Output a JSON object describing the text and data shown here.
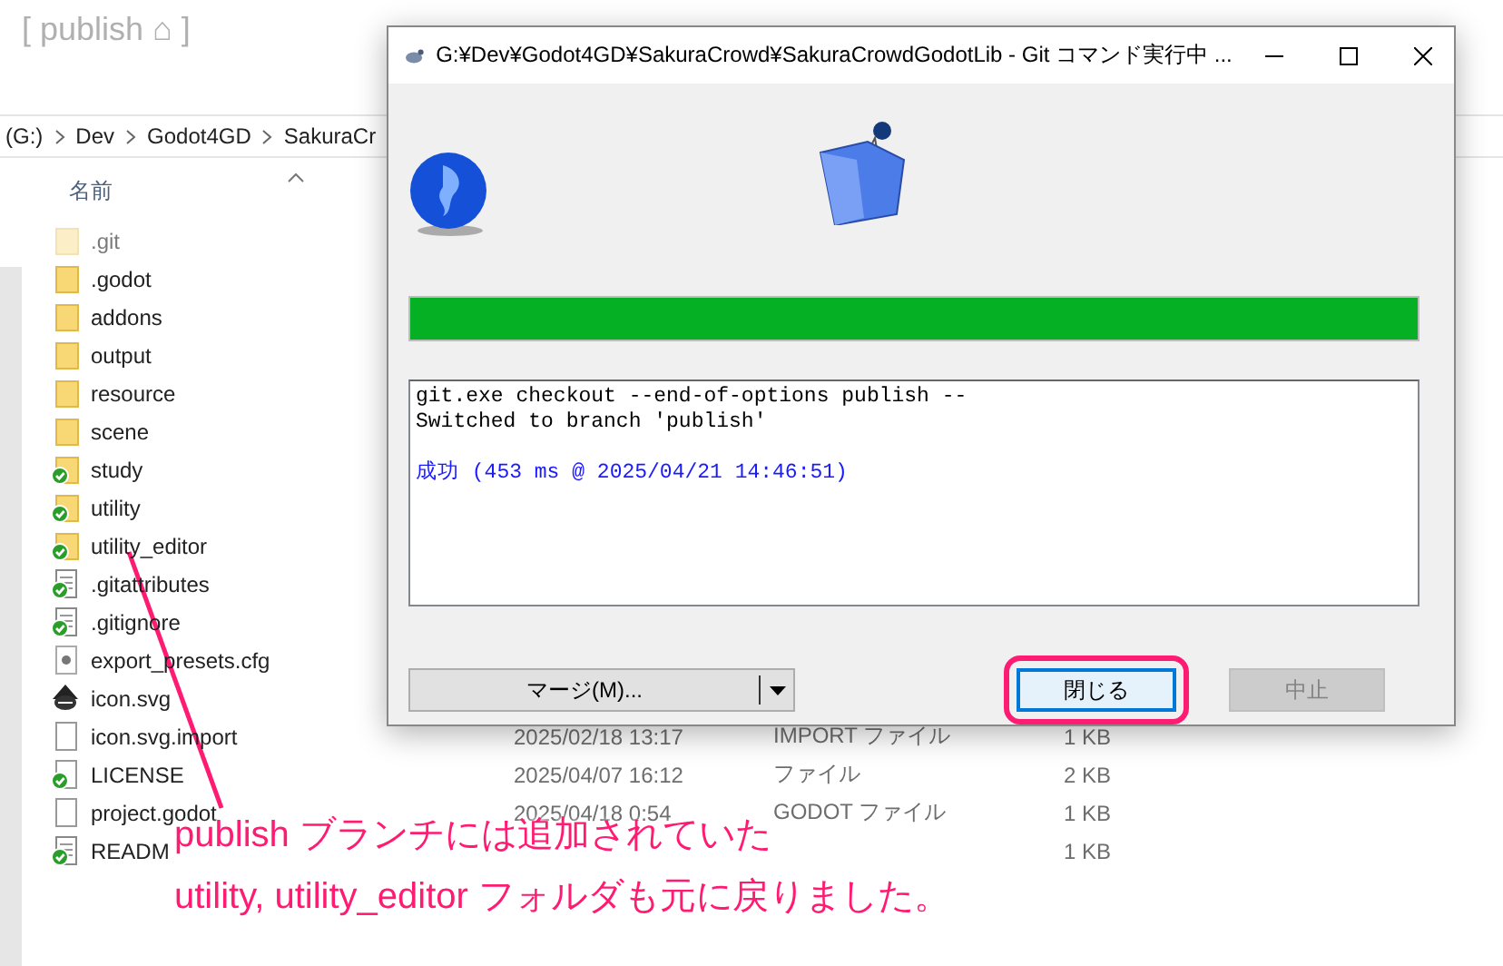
{
  "explorer": {
    "title": "[ publish ⌂ ]",
    "breadcrumb": [
      "(G:)",
      "Dev",
      "Godot4GD",
      "SakuraCr"
    ],
    "name_header": "名前",
    "files": [
      {
        "name": ".git",
        "kind": "folder",
        "hidden": true,
        "tracked": false
      },
      {
        "name": ".godot",
        "kind": "folder",
        "hidden": false,
        "tracked": false
      },
      {
        "name": "addons",
        "kind": "folder",
        "hidden": false,
        "tracked": false
      },
      {
        "name": "output",
        "kind": "folder",
        "hidden": false,
        "tracked": false
      },
      {
        "name": "resource",
        "kind": "folder",
        "hidden": false,
        "tracked": false
      },
      {
        "name": "scene",
        "kind": "folder",
        "hidden": false,
        "tracked": false
      },
      {
        "name": "study",
        "kind": "folder",
        "hidden": false,
        "tracked": true
      },
      {
        "name": "utility",
        "kind": "folder",
        "hidden": false,
        "tracked": true
      },
      {
        "name": "utility_editor",
        "kind": "folder",
        "hidden": false,
        "tracked": true
      },
      {
        "name": ".gitattributes",
        "kind": "text",
        "hidden": false,
        "tracked": true
      },
      {
        "name": ".gitignore",
        "kind": "text",
        "hidden": false,
        "tracked": true
      },
      {
        "name": "export_presets.cfg",
        "kind": "config",
        "hidden": false,
        "tracked": false
      },
      {
        "name": "icon.svg",
        "kind": "vector",
        "hidden": false,
        "tracked": false
      },
      {
        "name": "icon.svg.import",
        "kind": "file",
        "hidden": false,
        "tracked": false,
        "date": "2025/02/18 13:17",
        "type": "IMPORT ファイル",
        "size": "1 KB"
      },
      {
        "name": "LICENSE",
        "kind": "file",
        "hidden": false,
        "tracked": true,
        "date": "2025/04/07 16:12",
        "type": "ファイル",
        "size": "2 KB"
      },
      {
        "name": "project.godot",
        "kind": "file",
        "hidden": false,
        "tracked": false,
        "date": "2025/04/18 0:54",
        "type": "GODOT ファイル",
        "size": "1 KB"
      },
      {
        "name": "READM",
        "kind": "text",
        "hidden": false,
        "tracked": true,
        "size": "1 KB"
      }
    ]
  },
  "dialog": {
    "title": "G:¥Dev¥Godot4GD¥SakuraCrowd¥SakuraCrowdGodotLib - Git コマンド実行中 ...",
    "progress": {
      "level": 1
    },
    "log": [
      {
        "text": "git.exe checkout --end-of-options publish --",
        "kind": "output"
      },
      {
        "text": "Switched to branch 'publish'",
        "kind": "output"
      },
      {
        "text": "成功 (453 ms @ 2025/04/21 14:46:51)",
        "kind": "success"
      }
    ],
    "merge_button": {
      "label": "マージ(M)..."
    },
    "close_button": {
      "label": "閉じる",
      "highlighted": true
    },
    "abort_button": {
      "label": "中止",
      "disabled": true
    }
  },
  "annotation": {
    "lines": [
      "publish ブランチには追加されていた",
      "utility, utility_editor フォルダも元に戻りました。"
    ]
  }
}
